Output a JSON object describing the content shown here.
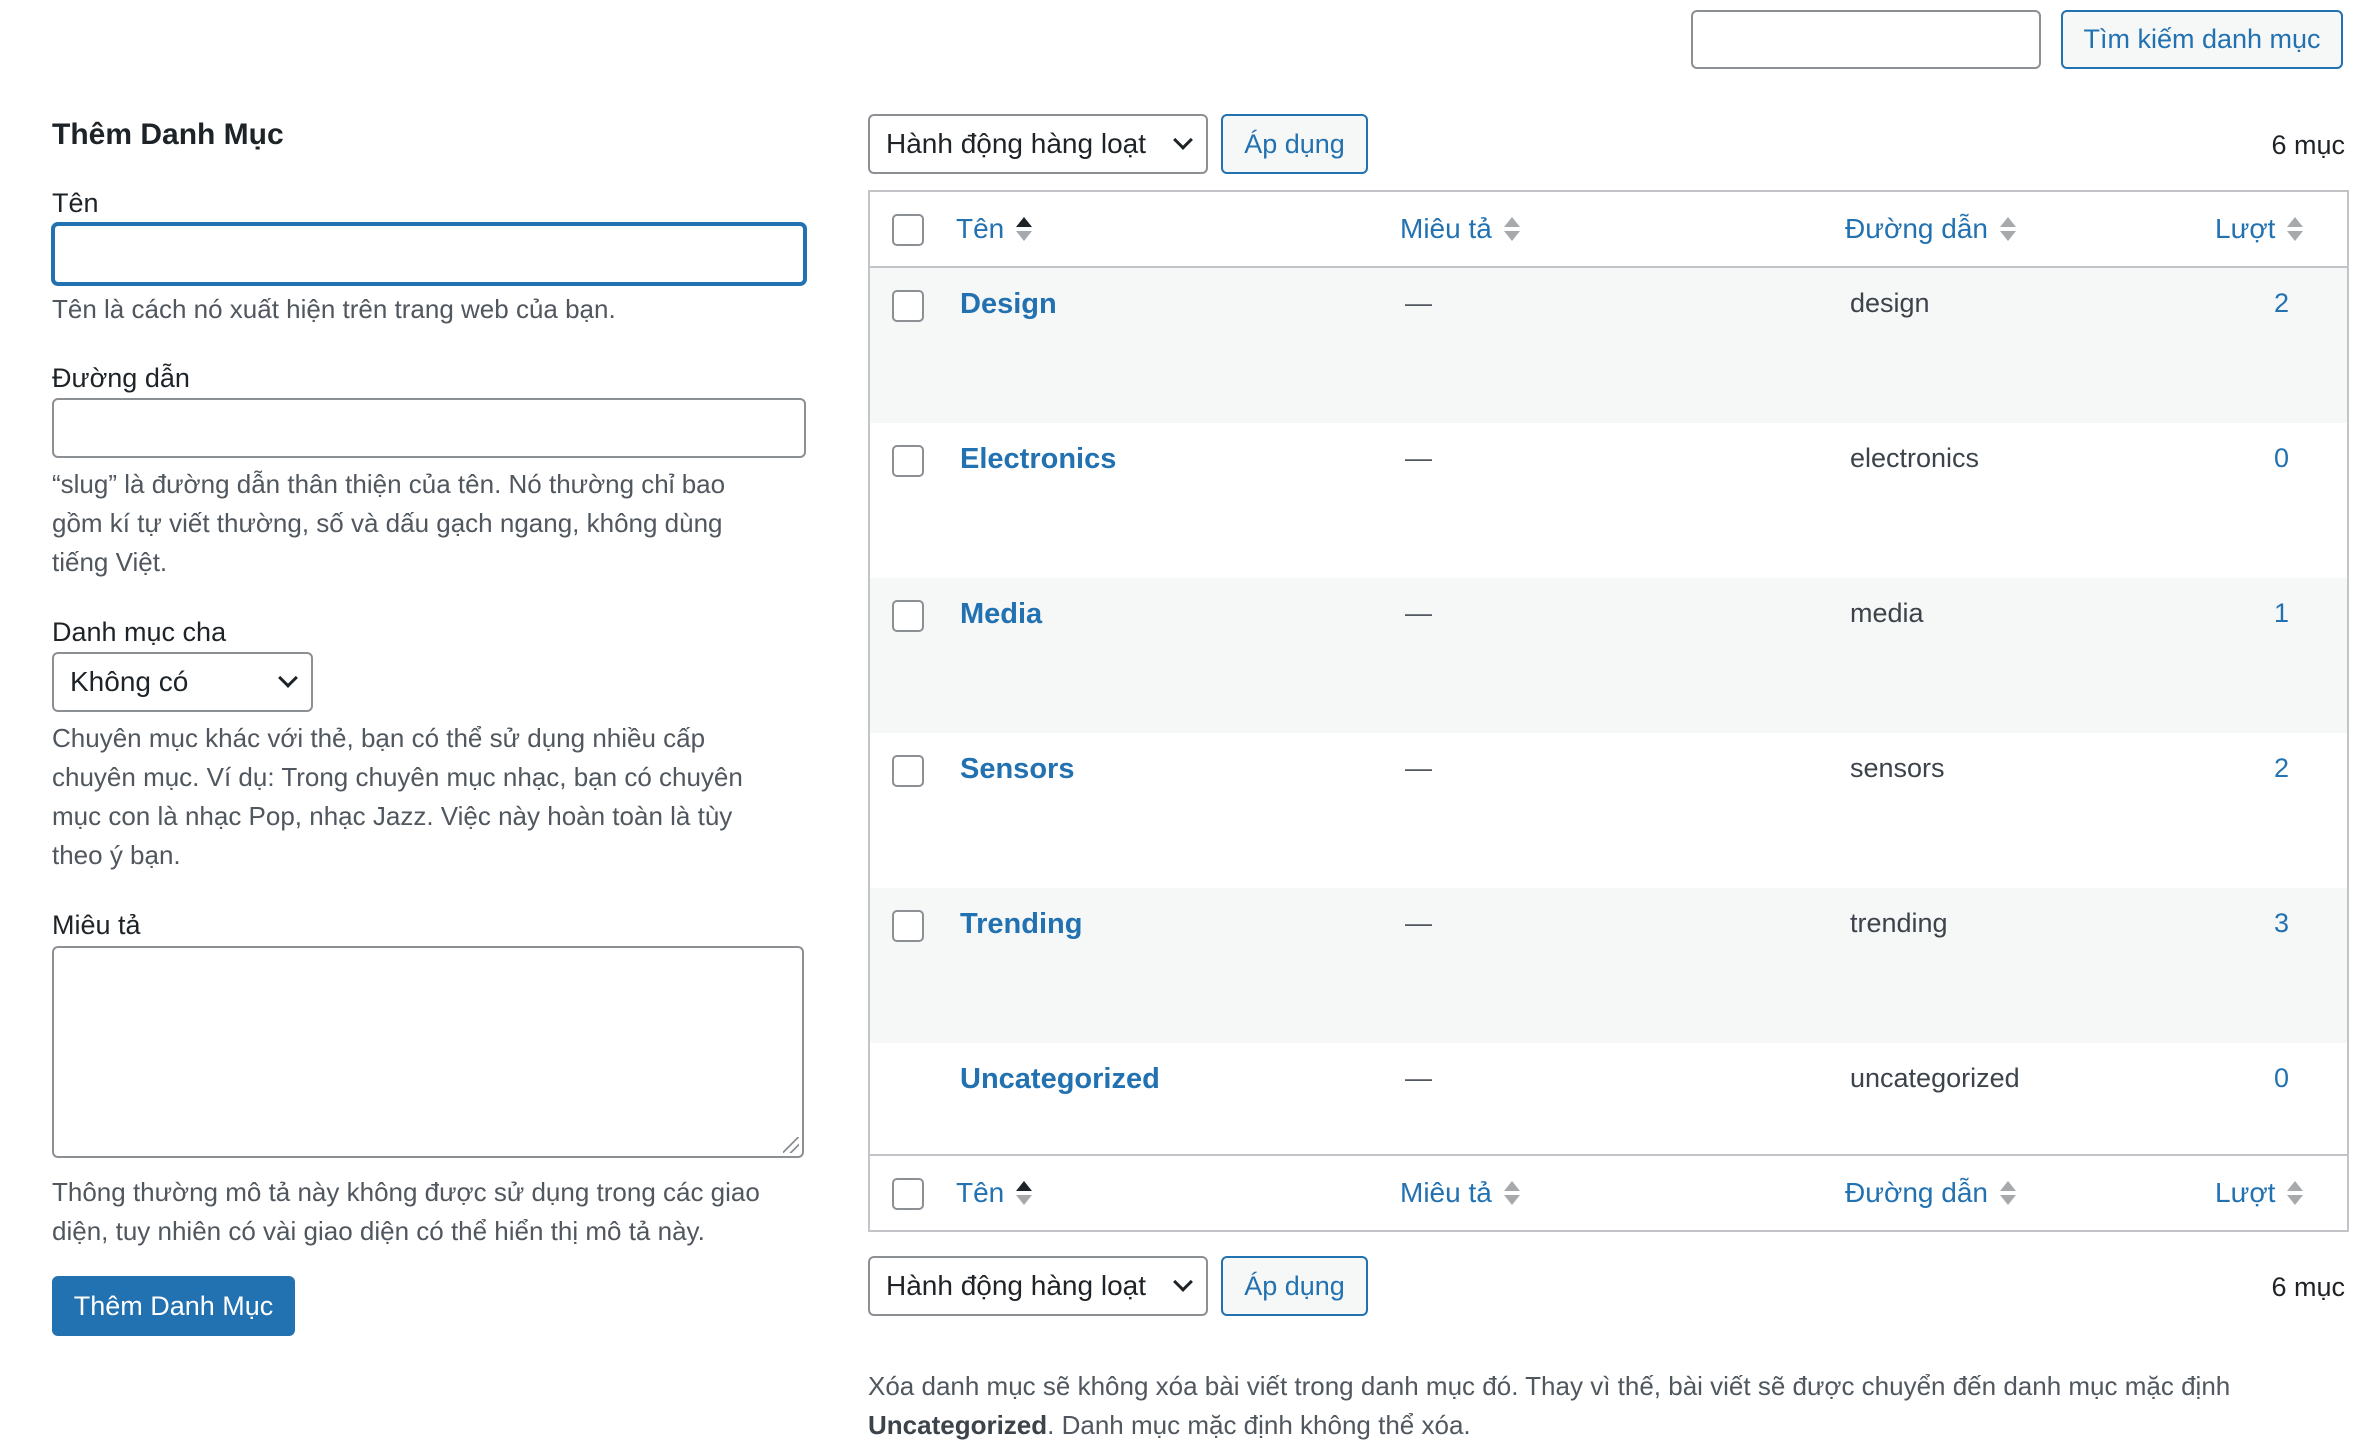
{
  "search": {
    "placeholder": "",
    "button_label": "Tìm kiếm danh mục"
  },
  "form": {
    "title": "Thêm Danh Mục",
    "name_label": "Tên",
    "name_help": "Tên là cách nó xuất hiện trên trang web của bạn.",
    "slug_label": "Đường dẫn",
    "slug_help_1": "“slug” là đường dẫn thân thiện của tên. Nó thường chỉ bao",
    "slug_help_2": "gồm kí tự viết thường, số và dấu gạch ngang, không dùng",
    "slug_help_3": "tiếng Việt.",
    "parent_label": "Danh mục cha",
    "parent_selected": "Không có",
    "parent_help_1": "Chuyên mục khác với thẻ, bạn có thể sử dụng nhiều cấp",
    "parent_help_2": "chuyên mục. Ví dụ: Trong chuyên mục nhạc, bạn có chuyên",
    "parent_help_3": "mục con là nhạc Pop, nhạc Jazz. Việc này hoàn toàn là tùy",
    "parent_help_4": "theo ý bạn.",
    "desc_label": "Miêu tả",
    "desc_help_1": "Thông thường mô tả này không được sử dụng trong các giao",
    "desc_help_2": "diện, tuy nhiên có vài giao diện có thể hiển thị mô tả này.",
    "submit_label": "Thêm Danh Mục"
  },
  "bulk": {
    "selected": "Hành động hàng loạt",
    "apply_label": "Áp dụng",
    "count": "6 mục"
  },
  "columns": {
    "name": "Tên",
    "description": "Miêu tả",
    "slug": "Đường dẫn",
    "count": "Lượt"
  },
  "rows": [
    {
      "name": "Design",
      "description": "—",
      "slug": "design",
      "count": "2"
    },
    {
      "name": "Electronics",
      "description": "—",
      "slug": "electronics",
      "count": "0"
    },
    {
      "name": "Media",
      "description": "—",
      "slug": "media",
      "count": "1"
    },
    {
      "name": "Sensors",
      "description": "—",
      "slug": "sensors",
      "count": "2"
    },
    {
      "name": "Trending",
      "description": "—",
      "slug": "trending",
      "count": "3"
    },
    {
      "name": "Uncategorized",
      "description": "—",
      "slug": "uncategorized",
      "count": "0"
    }
  ],
  "note": {
    "part1": "Xóa danh mục sẽ không xóa bài viết trong danh mục đó. Thay vì thế, bài viết sẽ được chuyển đến danh mục mặc định",
    "bold": "Uncategorized",
    "part2": ". Danh mục mặc định không thể xóa."
  },
  "colors": {
    "accent": "#2271b1",
    "row_alt": "#f6f7f7",
    "border": "#c3c4c7"
  }
}
